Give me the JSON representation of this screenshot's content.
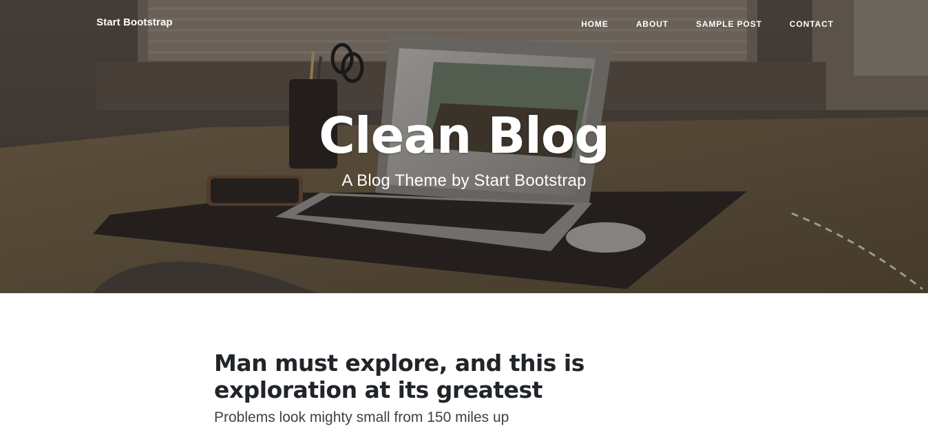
{
  "navbar": {
    "brand": "Start Bootstrap",
    "links": [
      {
        "label": "Home"
      },
      {
        "label": "About"
      },
      {
        "label": "Sample Post"
      },
      {
        "label": "Contact"
      }
    ]
  },
  "hero": {
    "title": "Clean Blog",
    "subheading": "A Blog Theme by Start Bootstrap"
  },
  "posts": [
    {
      "title": "Man must explore, and this is exploration at its greatest",
      "subtitle": "Problems look mighty small from 150 miles up"
    }
  ],
  "colors": {
    "heading_text": "#212529",
    "subtitle_text": "#404040",
    "hero_text": "#ffffff"
  }
}
